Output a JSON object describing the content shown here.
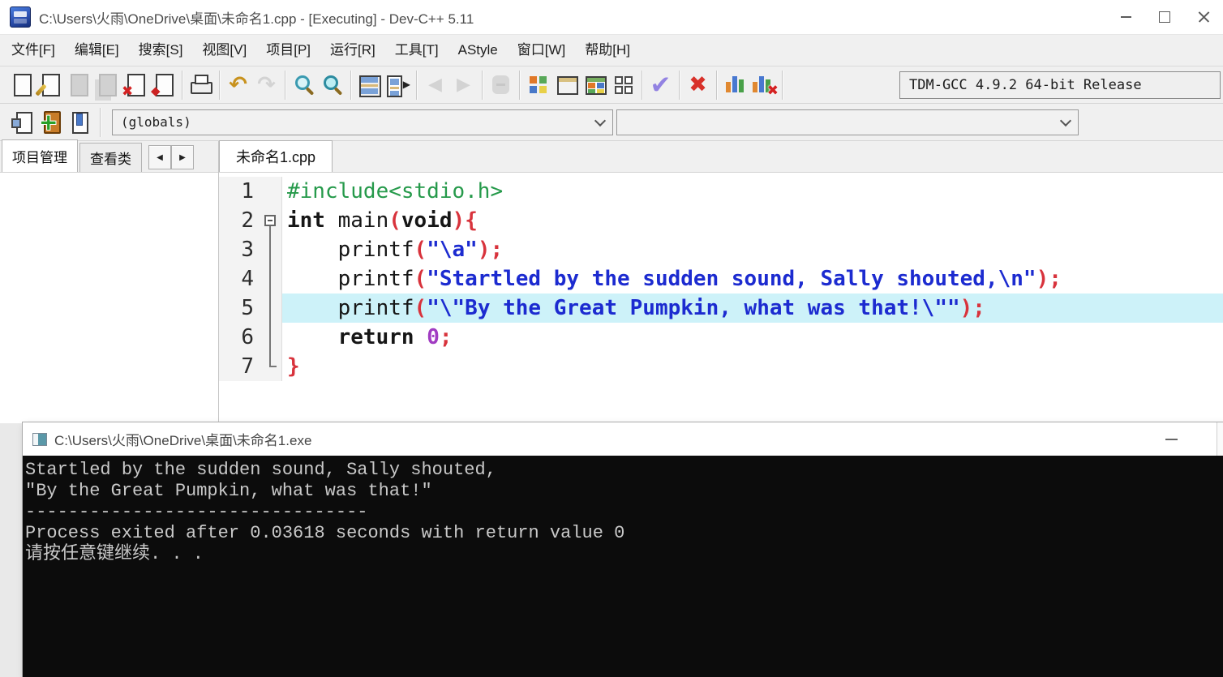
{
  "window": {
    "title": "C:\\Users\\火雨\\OneDrive\\桌面\\未命名1.cpp - [Executing] - Dev-C++ 5.11"
  },
  "menu": {
    "items": [
      "文件[F]",
      "编辑[E]",
      "搜索[S]",
      "视图[V]",
      "项目[P]",
      "运行[R]",
      "工具[T]",
      "AStyle",
      "窗口[W]",
      "帮助[H]"
    ]
  },
  "toolbar": {
    "compiler": "TDM-GCC 4.9.2 64-bit Release",
    "groups": [
      [
        {
          "name": "new-file",
          "kind": "page"
        },
        {
          "name": "open-file",
          "kind": "page-pen"
        },
        {
          "name": "save",
          "kind": "page-gray",
          "disabled": true
        },
        {
          "name": "save-all",
          "kind": "pages-gray",
          "disabled": true
        },
        {
          "name": "close-file",
          "kind": "page-x"
        },
        {
          "name": "close-all",
          "kind": "page-star"
        }
      ],
      [
        {
          "name": "print",
          "kind": "print"
        }
      ],
      [
        {
          "name": "undo",
          "kind": "char",
          "char": "↶",
          "color": "#c8921e",
          "size": 27
        },
        {
          "name": "redo",
          "kind": "char",
          "char": "↷",
          "color": "#bdbdbd",
          "size": 27,
          "disabled": true
        }
      ],
      [
        {
          "name": "find",
          "kind": "magnifier"
        },
        {
          "name": "replace",
          "kind": "magnifier2"
        }
      ],
      [
        {
          "name": "split-editor",
          "kind": "split1"
        },
        {
          "name": "swap-header-source",
          "kind": "split2"
        }
      ],
      [
        {
          "name": "back",
          "kind": "char",
          "char": "◀",
          "color": "#bdbdbd",
          "size": 22,
          "disabled": true
        },
        {
          "name": "forward",
          "kind": "char",
          "char": "▶",
          "color": "#bdbdbd",
          "size": 22,
          "disabled": true
        }
      ],
      [
        {
          "name": "toggle-breakpoint",
          "kind": "blob",
          "disabled": true
        }
      ],
      [
        {
          "name": "new-project",
          "kind": "grid-color"
        },
        {
          "name": "new-window",
          "kind": "win"
        },
        {
          "name": "project-options",
          "kind": "win-color"
        },
        {
          "name": "package-manager",
          "kind": "grid-plain"
        }
      ],
      [
        {
          "name": "compile",
          "kind": "char",
          "char": "✔",
          "color": "#9282e2",
          "size": 31
        }
      ],
      [
        {
          "name": "stop-execution",
          "kind": "char",
          "char": "✖",
          "color": "#d8312a",
          "size": 27
        }
      ],
      [
        {
          "name": "profile-analysis",
          "kind": "bars"
        },
        {
          "name": "delete-profiling",
          "kind": "bars-x"
        }
      ]
    ]
  },
  "toolbar2": {
    "icons": [
      {
        "name": "goto-declaration",
        "kind": "ins"
      },
      {
        "name": "new-unit",
        "kind": "book-add"
      },
      {
        "name": "toggle-bookmark",
        "kind": "bmk"
      }
    ],
    "globals": "(globals)",
    "member": ""
  },
  "left_panel": {
    "tabs": [
      "项目管理",
      "查看类"
    ],
    "scroll_left": "◀",
    "scroll_right": "▶"
  },
  "editor": {
    "tab_label": "未命名1.cpp",
    "lines": [
      {
        "num": 1,
        "fold": null,
        "highlighted": false,
        "tokens": [
          {
            "t": "#include<stdio.h>",
            "c": "pre"
          }
        ]
      },
      {
        "num": 2,
        "fold": "start",
        "highlighted": false,
        "tokens": [
          {
            "t": "int",
            "c": "kw"
          },
          {
            "t": " main",
            "c": "pln"
          },
          {
            "t": "(",
            "c": "sym"
          },
          {
            "t": "void",
            "c": "kw"
          },
          {
            "t": ")",
            "c": "sym"
          },
          {
            "t": "{",
            "c": "sym"
          }
        ]
      },
      {
        "num": 3,
        "fold": "mid",
        "highlighted": false,
        "tokens": [
          {
            "t": "    printf",
            "c": "pln"
          },
          {
            "t": "(",
            "c": "sym"
          },
          {
            "t": "\"\\a\"",
            "c": "str"
          },
          {
            "t": ");",
            "c": "sym"
          }
        ]
      },
      {
        "num": 4,
        "fold": "mid",
        "highlighted": false,
        "tokens": [
          {
            "t": "    printf",
            "c": "pln"
          },
          {
            "t": "(",
            "c": "sym"
          },
          {
            "t": "\"Startled by the sudden sound, Sally shouted,\\n\"",
            "c": "str"
          },
          {
            "t": ");",
            "c": "sym"
          }
        ]
      },
      {
        "num": 5,
        "fold": "mid",
        "highlighted": true,
        "tokens": [
          {
            "t": "    printf",
            "c": "pln"
          },
          {
            "t": "(",
            "c": "sym"
          },
          {
            "t": "\"\\\"By the Great Pumpkin, what was that!\\\"\"",
            "c": "str"
          },
          {
            "t": ");",
            "c": "sym"
          }
        ]
      },
      {
        "num": 6,
        "fold": "mid",
        "highlighted": false,
        "tokens": [
          {
            "t": "    ",
            "c": "pln"
          },
          {
            "t": "return",
            "c": "kw"
          },
          {
            "t": " ",
            "c": "pln"
          },
          {
            "t": "0",
            "c": "num"
          },
          {
            "t": ";",
            "c": "sym"
          }
        ]
      },
      {
        "num": 7,
        "fold": "end",
        "highlighted": false,
        "tokens": [
          {
            "t": "}",
            "c": "sym"
          }
        ]
      }
    ]
  },
  "console": {
    "title": "C:\\Users\\火雨\\OneDrive\\桌面\\未命名1.exe",
    "lines": [
      "Startled by the sudden sound, Sally shouted,",
      "\"By the Great Pumpkin, what was that!\"",
      "--------------------------------",
      "Process exited after 0.03618 seconds with return value 0",
      "请按任意键继续. . ."
    ]
  },
  "colors": {
    "highlight_line": "#cdf2f9",
    "string": "#1c2bd0",
    "symbol": "#d8333c",
    "preprocessor": "#269a4b",
    "number": "#a13cc2",
    "console_bg": "#0c0c0c",
    "console_fg": "#c9c9c9",
    "chrome_bg": "#f0f0f0"
  }
}
